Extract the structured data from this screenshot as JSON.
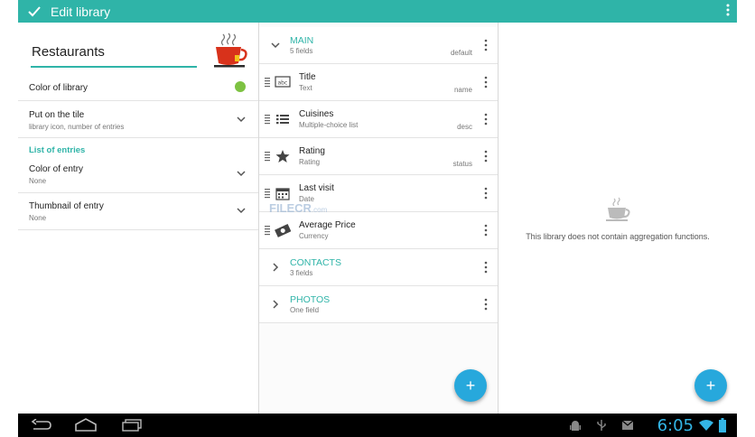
{
  "app": {
    "title": "Edit library"
  },
  "colors": {
    "accent": "#2fb4a8",
    "fab": "#27a8dc",
    "library_dot": "#7dc242",
    "clock": "#33b5e5"
  },
  "left": {
    "library_name": "Restaurants",
    "library_icon": "coffee-cup-icon",
    "rows": [
      {
        "title": "Color of library"
      },
      {
        "title": "Put on the tile",
        "subtitle": "library icon, number of entries"
      }
    ],
    "section": "List of entries",
    "entry_rows": [
      {
        "title": "Color of entry",
        "subtitle": "None"
      },
      {
        "title": "Thumbnail of entry",
        "subtitle": "None"
      }
    ]
  },
  "middle": {
    "groups": [
      {
        "name": "MAIN",
        "sub": "5 fields",
        "right": "default",
        "expanded": true
      },
      {
        "name": "CONTACTS",
        "sub": "3 fields",
        "expanded": false
      },
      {
        "name": "PHOTOS",
        "sub": "One field",
        "expanded": false
      }
    ],
    "fields": [
      {
        "title": "Title",
        "type": "Text",
        "right": "name",
        "icon": "text-field-icon"
      },
      {
        "title": "Cuisines",
        "type": "Multiple-choice list",
        "right": "desc",
        "icon": "list-icon"
      },
      {
        "title": "Rating",
        "type": "Rating",
        "right": "status",
        "icon": "star-icon"
      },
      {
        "title": "Last visit",
        "type": "Date",
        "right": "",
        "icon": "calendar-icon"
      },
      {
        "title": "Average Price",
        "type": "Currency",
        "right": "",
        "icon": "money-icon"
      }
    ]
  },
  "right": {
    "empty_message": "This library does not contain aggregation functions."
  },
  "fab": {
    "label": "+"
  },
  "statusbar": {
    "time": "6:05"
  },
  "watermark": {
    "text": "FILECR",
    "suffix": ".com"
  }
}
